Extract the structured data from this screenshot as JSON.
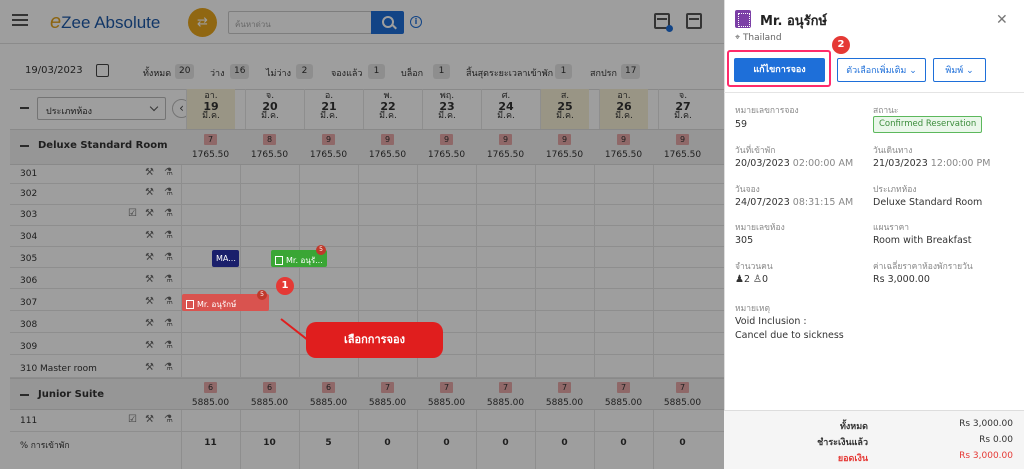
{
  "app": {
    "name_prefix": "e",
    "name_rest": "Zee Absolute",
    "search_placeholder": "ค้นหาด่วน"
  },
  "toolbar": {
    "date": "19/03/2023",
    "stats": [
      {
        "label": "ทั้งหมด",
        "count": "20"
      },
      {
        "label": "ว่าง",
        "count": "16"
      },
      {
        "label": "ไม่ว่าง",
        "count": "2"
      },
      {
        "label": "จองแล้ว",
        "count": "1"
      },
      {
        "label": "บล็อก",
        "count": "1"
      },
      {
        "label": "สิ้นสุดระยะเวลาเข้าพัก",
        "count": "1"
      },
      {
        "label": "สกปรก",
        "count": "17"
      }
    ]
  },
  "grid": {
    "room_type_select": "ประเภทห้อง",
    "days": [
      {
        "w": "อา.",
        "d": "19",
        "m": "มี.ค."
      },
      {
        "w": "จ.",
        "d": "20",
        "m": "มี.ค."
      },
      {
        "w": "อ.",
        "d": "21",
        "m": "มี.ค."
      },
      {
        "w": "พ.",
        "d": "22",
        "m": "มี.ค."
      },
      {
        "w": "พฤ.",
        "d": "23",
        "m": "มี.ค."
      },
      {
        "w": "ศ.",
        "d": "24",
        "m": "มี.ค."
      },
      {
        "w": "ส.",
        "d": "25",
        "m": "มี.ค."
      },
      {
        "w": "อา.",
        "d": "26",
        "m": "มี.ค."
      },
      {
        "w": "จ.",
        "d": "27",
        "m": "มี.ค."
      }
    ],
    "groups": [
      {
        "name": "Deluxe Standard Room",
        "avail": [
          "7",
          "8",
          "9",
          "9",
          "9",
          "9",
          "9",
          "9",
          "9"
        ],
        "rates": [
          "1765.50",
          "1765.50",
          "1765.50",
          "1765.50",
          "1765.50",
          "1765.50",
          "1765.50",
          "1765.50",
          "1765.50"
        ]
      },
      {
        "name": "Junior Suite",
        "avail": [
          "6",
          "6",
          "6",
          "7",
          "7",
          "7",
          "7",
          "7",
          "7"
        ],
        "rates": [
          "5885.00",
          "5885.00",
          "5885.00",
          "5885.00",
          "5885.00",
          "5885.00",
          "5885.00",
          "5885.00",
          "5885.00"
        ]
      }
    ],
    "rooms": [
      "301",
      "302",
      "303",
      "304",
      "305",
      "306",
      "307",
      "308",
      "309",
      "310 Master room"
    ],
    "junior_rooms": [
      "111"
    ],
    "occupancy_label": "% การเข้าพัก",
    "occupancy": [
      "11",
      "10",
      "5",
      "0",
      "0",
      "0",
      "0",
      "0",
      "0"
    ],
    "reservations": [
      {
        "label": "MA...",
        "color": "#1a1f6b"
      },
      {
        "label": "Mr. อนุรั...",
        "color": "#3aa635",
        "badge": "5"
      },
      {
        "label": "Mr. อนุรักษ์",
        "color": "#d9534f",
        "badge": "5"
      }
    ]
  },
  "callouts": {
    "one": "1",
    "two": "2",
    "tooltip": "เลือกการจอง"
  },
  "panel": {
    "guest": "Mr. อนุรักษ์",
    "location": "Thailand",
    "buttons": {
      "edit": "แก้ไขการจอง",
      "more": "ตัวเลือกเพิ่มเติม",
      "print": "พิมพ์"
    },
    "fields": {
      "res_no_label": "หมายเลขการจอง",
      "res_no": "59",
      "status_label": "สถานะ",
      "status": "Confirmed Reservation",
      "checkin_label": "วันที่เข้าพัก",
      "checkin_date": "20/03/2023",
      "checkin_time": "02:00:00 AM",
      "checkout_label": "วันเดินทาง",
      "checkout_date": "21/03/2023",
      "checkout_time": "12:00:00 PM",
      "booked_label": "วันจอง",
      "booked_date": "24/07/2023",
      "booked_time": "08:31:15 AM",
      "roomtype_label": "ประเภทห้อง",
      "roomtype": "Deluxe Standard Room",
      "roomno_label": "หมายเลขห้อง",
      "roomno": "305",
      "rateplan_label": "แผนราคา",
      "rateplan": "Room with Breakfast",
      "pax_label": "จำนวนคน",
      "adults": "2",
      "children": "0",
      "avg_label": "ค่าเฉลี่ยราคาห้องพักรายวัน",
      "avg": "Rs 3,000.00",
      "note_label": "หมายเหตุ",
      "note1": "Void Inclusion :",
      "note2": "Cancel due to sickness"
    },
    "footer": {
      "total_label": "ทั้งหมด",
      "total": "Rs 3,000.00",
      "paid_label": "ชำระเงินแล้ว",
      "paid": "Rs 0.00",
      "balance_label": "ยอดเงิน",
      "balance": "Rs 3,000.00"
    }
  },
  "colors": {
    "primary": "#1e6fd9",
    "accent": "#e8a61e",
    "danger": "#e53935",
    "confirmed": "#5cb85c"
  }
}
